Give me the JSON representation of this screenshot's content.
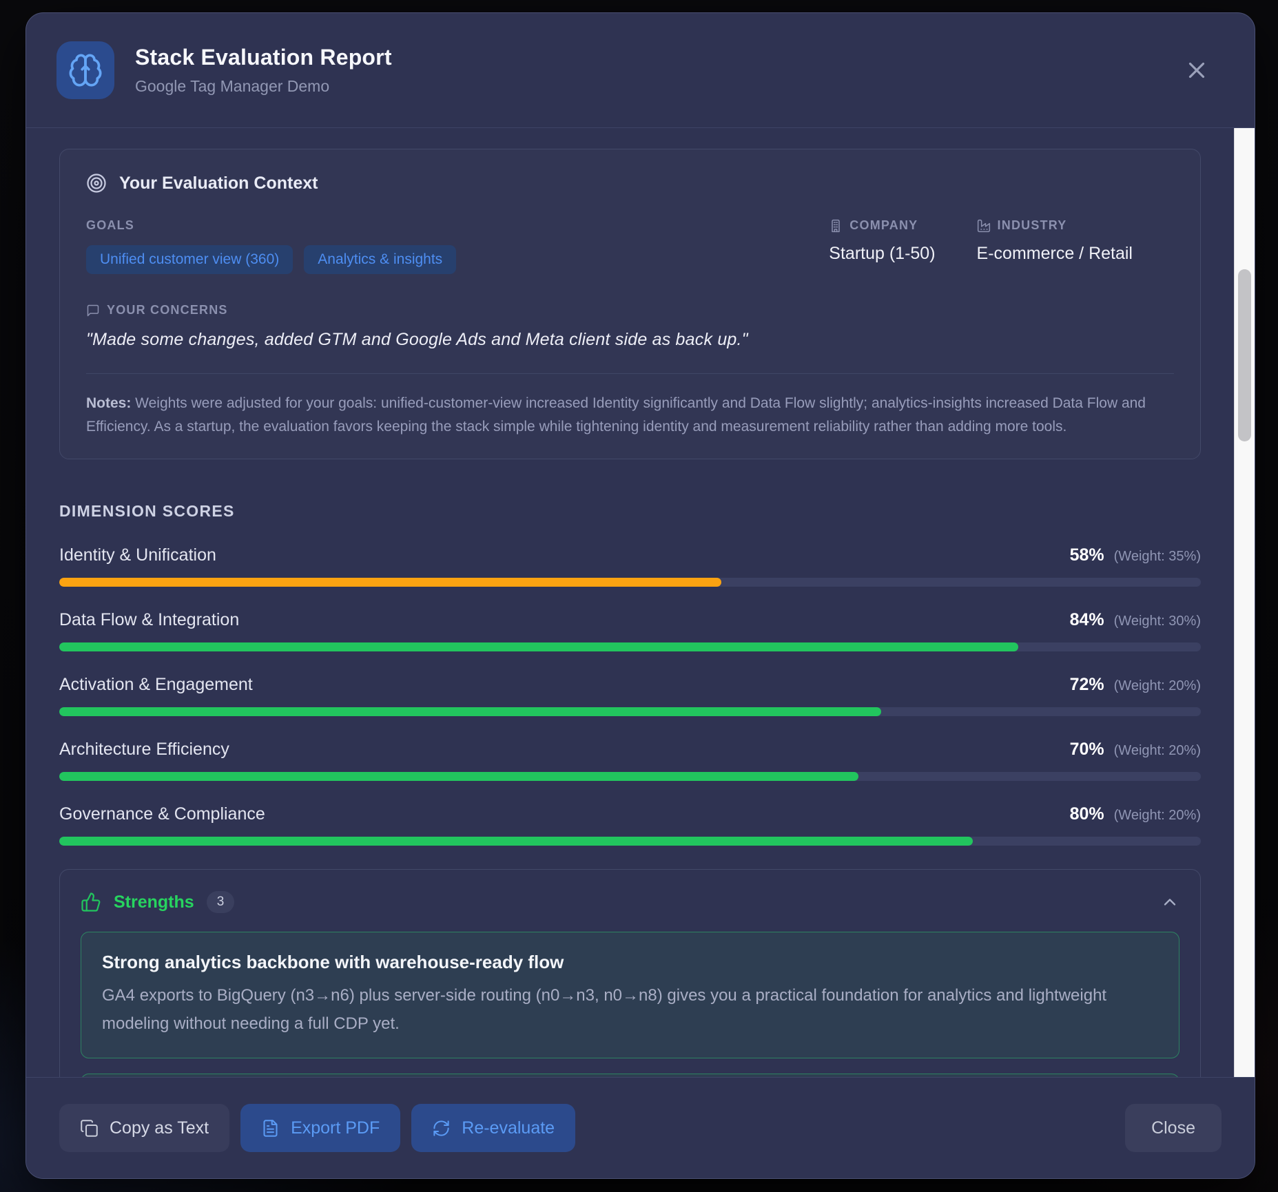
{
  "header": {
    "title": "Stack Evaluation Report",
    "subtitle": "Google Tag Manager Demo"
  },
  "context": {
    "title": "Your Evaluation Context",
    "goals_label": "GOALS",
    "goals": [
      "Unified customer view (360)",
      "Analytics & insights"
    ],
    "company_label": "COMPANY",
    "company_value": "Startup (1-50)",
    "industry_label": "INDUSTRY",
    "industry_value": "E-commerce / Retail",
    "concerns_label": "YOUR CONCERNS",
    "concerns_quote": "\"Made some changes, added GTM and Google Ads and Meta client side as back up.\"",
    "notes_label": "Notes:",
    "notes_body": " Weights were adjusted for your goals: unified-customer-view increased Identity significantly and Data Flow slightly; analytics-insights increased Data Flow and Efficiency. As a startup, the evaluation favors keeping the stack simple while tightening identity and measurement reliability rather than adding more tools."
  },
  "dimensions": {
    "heading": "DIMENSION SCORES",
    "items": [
      {
        "label": "Identity & Unification",
        "score": "58%",
        "weight": "(Weight: 35%)",
        "value": 58,
        "color": "#fba311"
      },
      {
        "label": "Data Flow & Integration",
        "score": "84%",
        "weight": "(Weight: 30%)",
        "value": 84,
        "color": "#22c55e"
      },
      {
        "label": "Activation & Engagement",
        "score": "72%",
        "weight": "(Weight: 20%)",
        "value": 72,
        "color": "#22c55e"
      },
      {
        "label": "Architecture Efficiency",
        "score": "70%",
        "weight": "(Weight: 20%)",
        "value": 70,
        "color": "#22c55e"
      },
      {
        "label": "Governance & Compliance",
        "score": "80%",
        "weight": "(Weight: 20%)",
        "value": 80,
        "color": "#22c55e"
      }
    ]
  },
  "strengths": {
    "title": "Strengths",
    "count": "3",
    "items": [
      {
        "title": "Strong analytics backbone with warehouse-ready flow",
        "body": "GA4 exports to BigQuery (n3→n6) plus server-side routing (n0→n3, n0→n8) gives you a practical foundation for analytics and lightweight modeling without needing a full CDP yet."
      }
    ]
  },
  "footer": {
    "copy_label": "Copy as Text",
    "export_label": "Export PDF",
    "reevaluate_label": "Re-evaluate",
    "close_label": "Close"
  },
  "colors": {
    "accent_blue": "#5b9bf5",
    "strength_green": "#22c55e",
    "warn_orange": "#fba311",
    "modal_bg": "#2f3352"
  }
}
